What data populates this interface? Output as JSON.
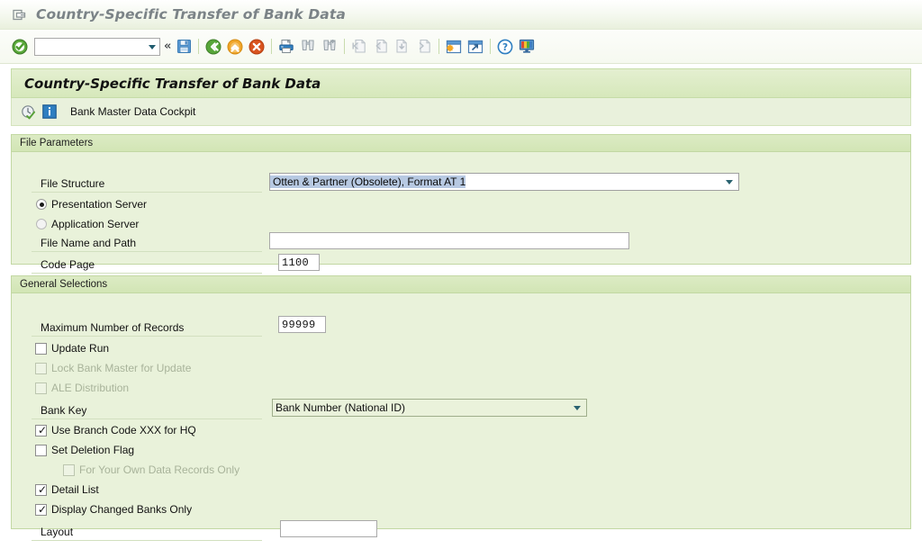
{
  "window": {
    "title": "Country-Specific Transfer of Bank Data",
    "title_icon": "open-folder-arrow-icon"
  },
  "toolbar": {
    "command_field": {
      "value": "",
      "placeholder": ""
    },
    "buttons": [
      {
        "name": "enter-button",
        "icon": "green-check-icon",
        "tooltip": "Enter"
      },
      {
        "name": "back-button",
        "icon": "back-green-icon",
        "tooltip": "Back"
      },
      {
        "name": "exit-button",
        "icon": "exit-yellow-icon",
        "tooltip": "Exit"
      },
      {
        "name": "cancel-button",
        "icon": "cancel-red-icon",
        "tooltip": "Cancel"
      },
      {
        "name": "print-button",
        "icon": "printer-icon",
        "tooltip": "Print"
      },
      {
        "name": "find-button",
        "icon": "binoculars-icon",
        "tooltip": "Find"
      },
      {
        "name": "find-next-button",
        "icon": "binoculars-plus-icon",
        "tooltip": "Find Next"
      },
      {
        "name": "first-page-button",
        "icon": "first-page-icon",
        "tooltip": "First Page"
      },
      {
        "name": "previous-page-button",
        "icon": "previous-page-icon",
        "tooltip": "Previous Page"
      },
      {
        "name": "next-page-button",
        "icon": "next-page-icon",
        "tooltip": "Next Page"
      },
      {
        "name": "last-page-button",
        "icon": "last-page-icon",
        "tooltip": "Last Page"
      },
      {
        "name": "create-session-button",
        "icon": "new-session-icon",
        "tooltip": "Create New Session"
      },
      {
        "name": "create-shortcut-button",
        "icon": "shortcut-icon",
        "tooltip": "Create Shortcut"
      },
      {
        "name": "help-button",
        "icon": "question-help-icon",
        "tooltip": "Help"
      },
      {
        "name": "customize-button",
        "icon": "customize-layout-icon",
        "tooltip": "Customizing of Local Layout"
      }
    ],
    "save_icon": "save-disk-icon",
    "collapse_glyph": "«"
  },
  "screen": {
    "title": "Country-Specific Transfer of Bank Data"
  },
  "app_toolbar": {
    "execute_icon": "execute-clock-check-icon",
    "info_icon": "information-icon",
    "label": "Bank Master Data Cockpit"
  },
  "file_parameters": {
    "header": "File Parameters",
    "file_structure": {
      "label": "File Structure",
      "value": "Otten & Partner (Obsolete), Format AT 1",
      "selected": true
    },
    "presentation_server": {
      "label": "Presentation Server",
      "checked": true
    },
    "application_server": {
      "label": "Application Server",
      "checked": false
    },
    "file_name_path": {
      "label": "File Name and Path",
      "value": ""
    },
    "code_page": {
      "label": "Code Page",
      "value": "1100"
    }
  },
  "general_selections": {
    "header": "General Selections",
    "max_records": {
      "label": "Maximum Number of Records",
      "value": "99999"
    },
    "update_run": {
      "label": "Update Run",
      "checked": false,
      "enabled": true
    },
    "lock_bank_master": {
      "label": "Lock Bank Master for Update",
      "checked": false,
      "enabled": false
    },
    "ale_distribution": {
      "label": "ALE Distribution",
      "checked": false,
      "enabled": false
    },
    "bank_key": {
      "label": "Bank Key",
      "value": "Bank Number (National ID)"
    },
    "use_branch_code": {
      "label": "Use Branch Code XXX for HQ",
      "checked": true,
      "enabled": true
    },
    "set_deletion_flag": {
      "label": "Set Deletion Flag",
      "checked": false,
      "enabled": true
    },
    "own_data_records": {
      "label": "For Your Own Data Records Only",
      "checked": false,
      "enabled": false
    },
    "detail_list": {
      "label": "Detail List",
      "checked": true,
      "enabled": true
    },
    "display_changed_banks": {
      "label": "Display Changed Banks Only",
      "checked": true,
      "enabled": true
    },
    "layout": {
      "label": "Layout",
      "value": ""
    }
  },
  "colors": {
    "panel_bg": "#e9f2da",
    "panel_header": "#d6e8bb",
    "panel_border": "#c2d8a3",
    "title_text": "#7b8387",
    "selection_blue": "#b7c9e2",
    "disabled_text": "#a8b39a"
  }
}
